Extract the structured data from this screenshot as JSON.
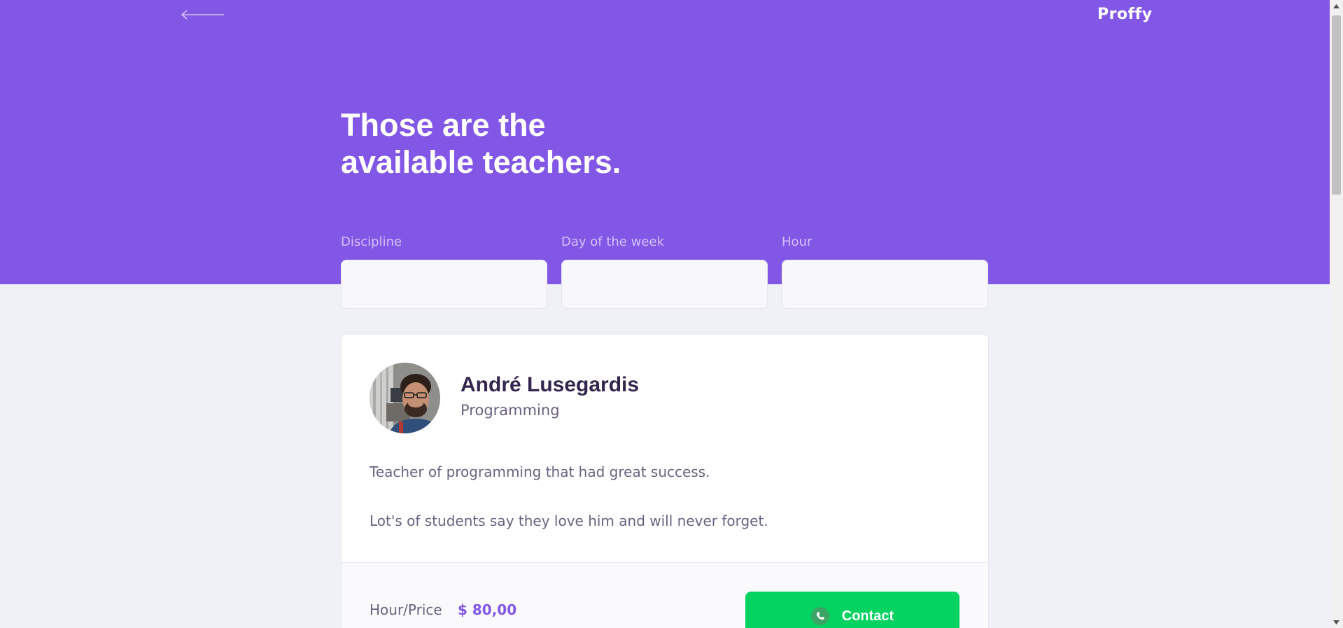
{
  "header": {
    "brand": "Proffy",
    "title_line1": "Those are the",
    "title_line2": "available teachers.",
    "background_color": "#8257e5"
  },
  "filters": [
    {
      "label": "Discipline",
      "value": ""
    },
    {
      "label": "Day of the week",
      "value": ""
    },
    {
      "label": "Hour",
      "value": ""
    }
  ],
  "teacher": {
    "name": "André Lusegardis",
    "subject": "Programming",
    "bio_line1": "Teacher of programming that had great success.",
    "bio_line2": "Lot's of students say they love him and will never forget.",
    "price_label": "Hour/Price",
    "price_value": "$ 80,00",
    "contact_label": "Contact"
  },
  "colors": {
    "accent": "#8257e5",
    "contact_green": "#04d361",
    "page_background": "#f0f0f7"
  },
  "icons": {
    "back": "arrow-left-icon",
    "contact": "whatsapp-icon"
  }
}
